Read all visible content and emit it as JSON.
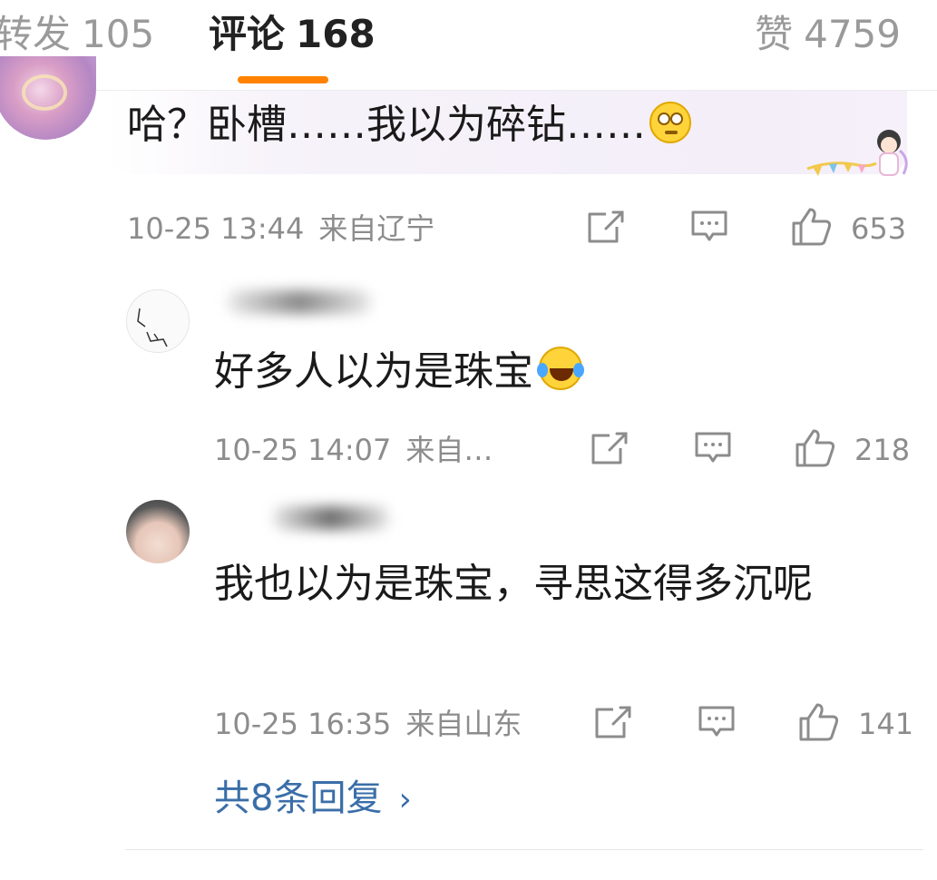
{
  "tabs": {
    "repost": {
      "label": "转发",
      "count": "105"
    },
    "comments": {
      "label": "评论",
      "count": "168"
    },
    "likes": {
      "label": "赞",
      "count": "4759"
    }
  },
  "accent_color": "#ff8200",
  "link_color": "#3a6ea8",
  "comment": {
    "text": "哈？卧槽……我以为碎钻……",
    "emoji": "thinking-face-icon",
    "time": "10-25 13:44",
    "location": "来自辽宁",
    "likes": "653"
  },
  "replies": [
    {
      "text": "好多人以为是珠宝",
      "emoji": "laughing-tears-icon",
      "time": "10-25 14:07",
      "location": "来自…",
      "likes": "218"
    },
    {
      "text": "我也以为是珠宝，寻思这得多沉呢",
      "time": "10-25 16:35",
      "location": "来自山东",
      "likes": "141"
    }
  ],
  "more_replies": "共8条回复",
  "icons": {
    "share": "share-icon",
    "reply": "reply-icon",
    "like": "thumbs-up-icon",
    "more": "chevron-right-icon"
  }
}
